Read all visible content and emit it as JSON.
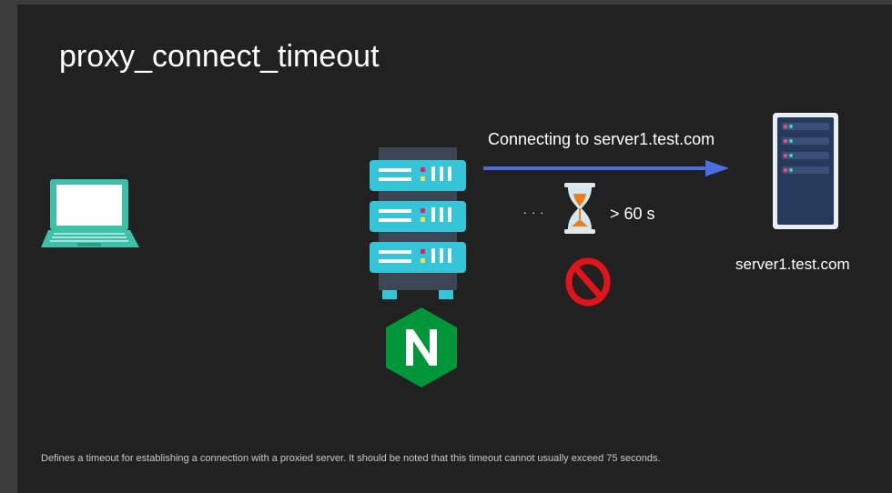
{
  "slide": {
    "title": "proxy_connect_timeout",
    "connection_label": "Connecting to server1.test.com",
    "wait_dots": ". . .",
    "timeout_label": "> 60 s",
    "server_label": "server1.test.com",
    "footnote": "Defines a timeout for establishing a connection with a proxied server. It should be noted that this timeout cannot usually exceed 75 seconds."
  },
  "icons": {
    "client": "laptop-icon",
    "proxy": "server-rack-icon",
    "proxy_brand": "nginx-logo-icon",
    "upstream": "server-tower-icon",
    "wait": "hourglass-icon",
    "blocked": "no-entry-icon"
  },
  "colors": {
    "background": "#212121",
    "arrow": "#4a6ee0",
    "server_teal": "#34c6d8",
    "nginx_green": "#009639",
    "blocked_red": "#e3131b",
    "laptop_teal": "#3cc1a9"
  }
}
